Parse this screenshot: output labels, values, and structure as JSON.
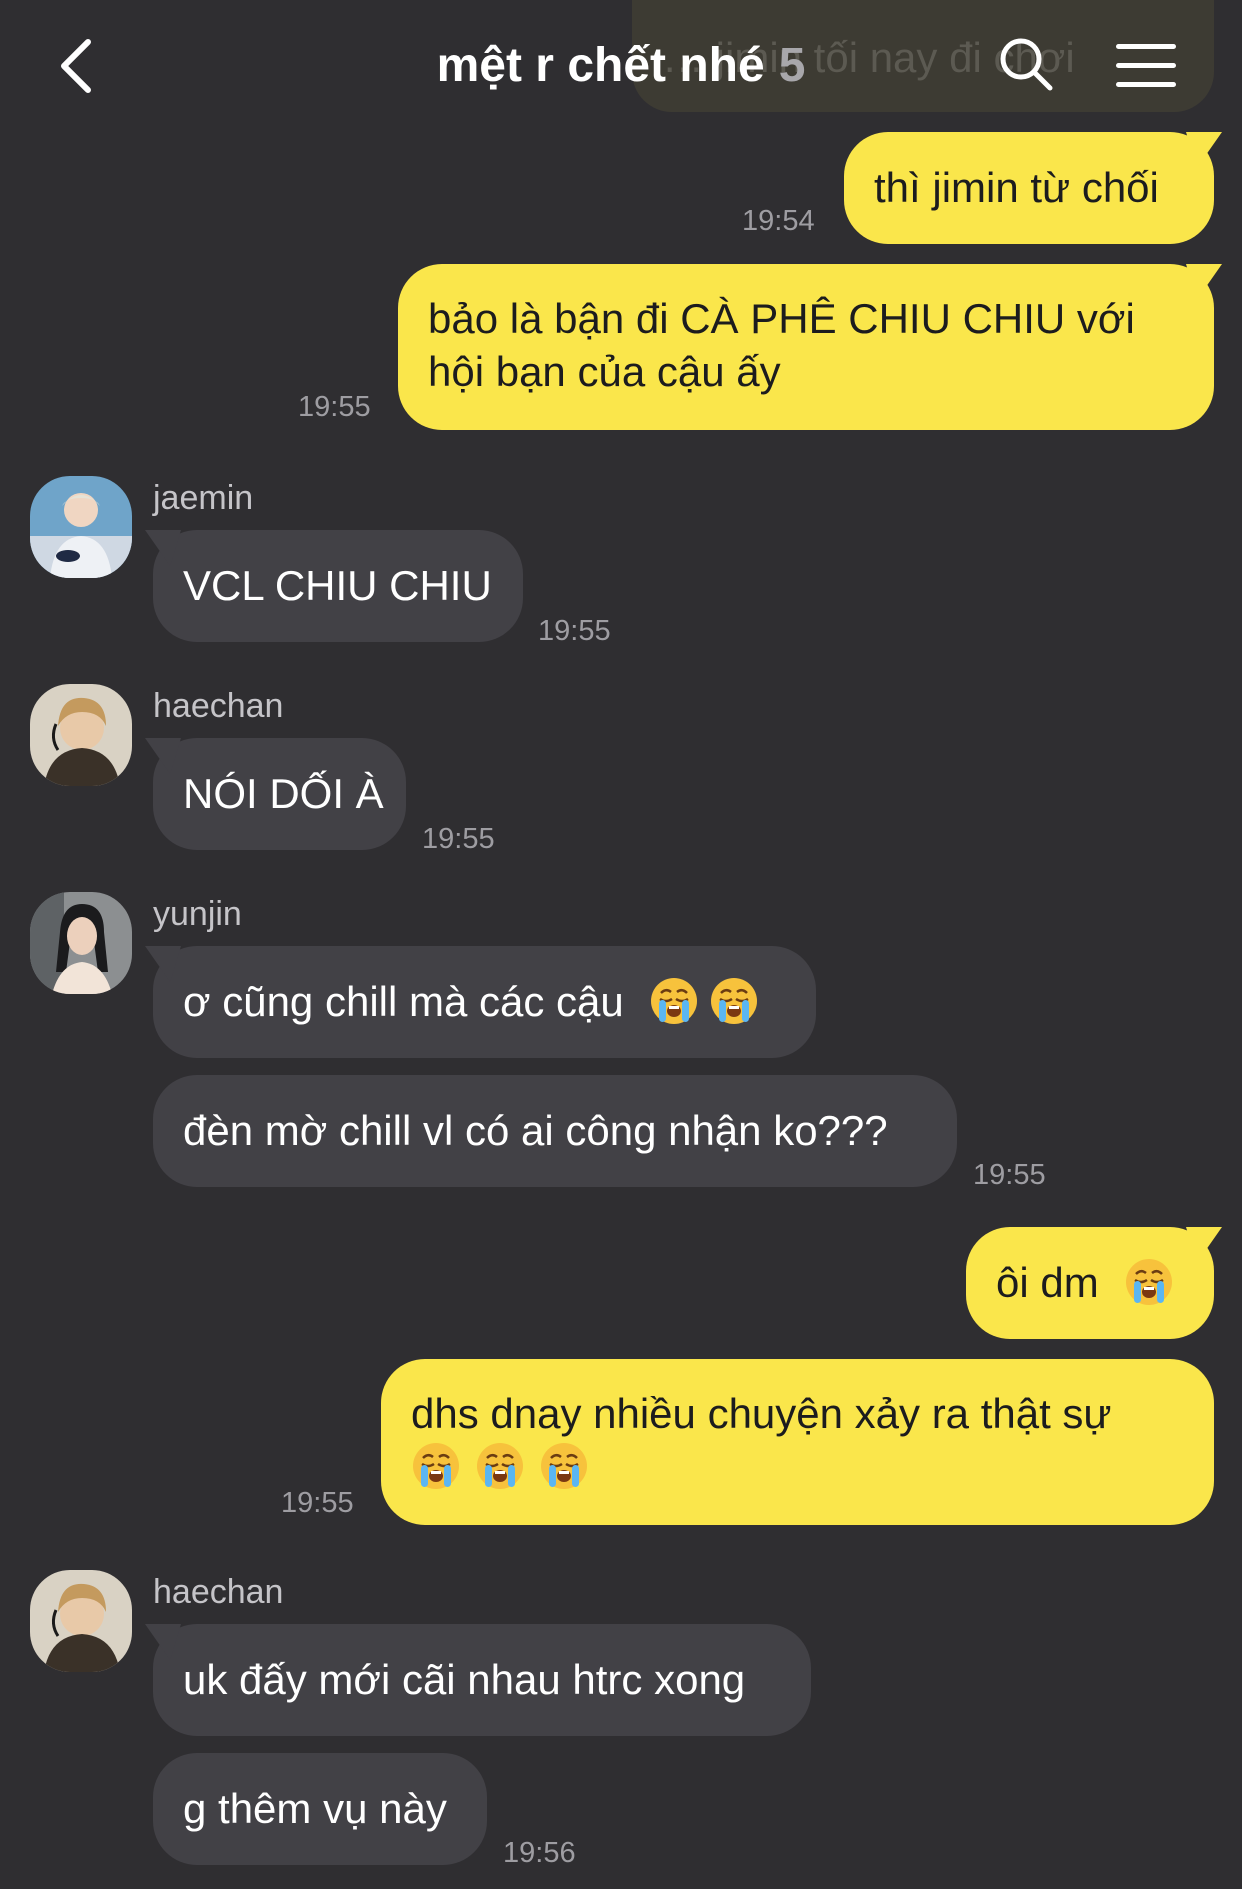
{
  "header": {
    "title": "mệt r chết nhé",
    "member_count": "5",
    "back_icon": "chevron-left-icon",
    "search_icon": "search-icon",
    "menu_icon": "hamburger-menu-icon"
  },
  "ghost_bubble": {
    "text": "… jimin tối nay đi chơi"
  },
  "colors": {
    "background": "#2f2e31",
    "my_bubble": "#fae64b",
    "their_bubble": "#424146",
    "timestamp": "#9e9da2"
  },
  "messages": [
    {
      "id": "m1",
      "side": "mine",
      "lines": [
        "thì jimin từ chối"
      ],
      "time": "19:54"
    },
    {
      "id": "m2",
      "side": "mine",
      "lines": [
        "bảo là bận đi CÀ PHÊ CHIU CHIU với",
        "hội bạn của cậu ấy"
      ],
      "time": "19:55"
    },
    {
      "id": "m3",
      "side": "theirs",
      "sender": "jaemin",
      "lines": [
        "VCL CHIU CHIU"
      ],
      "time": "19:55"
    },
    {
      "id": "m4",
      "side": "theirs",
      "sender": "haechan",
      "lines": [
        "NÓI DỐI À"
      ],
      "time": "19:55"
    },
    {
      "id": "m5",
      "side": "theirs",
      "sender": "yunjin",
      "lines": [
        "ơ cũng chill mà các cậu"
      ],
      "emoji": "loudly-crying-face x2"
    },
    {
      "id": "m6",
      "side": "theirs",
      "lines": [
        "đèn mờ chill vl có ai công nhận ko???"
      ],
      "time": "19:55"
    },
    {
      "id": "m7",
      "side": "mine",
      "lines": [
        "ôi dm"
      ],
      "emoji": "loudly-crying-face"
    },
    {
      "id": "m8",
      "side": "mine",
      "lines": [
        "dhs dnay nhiều chuyện xảy ra thật sự"
      ],
      "emoji": "loudly-crying-face x3",
      "time": "19:55"
    },
    {
      "id": "m9",
      "side": "theirs",
      "sender": "haechan",
      "lines": [
        "uk đấy mới cãi nhau htrc xong"
      ]
    },
    {
      "id": "m10",
      "side": "theirs",
      "lines": [
        "g thêm vụ này"
      ],
      "time": "19:56"
    }
  ]
}
